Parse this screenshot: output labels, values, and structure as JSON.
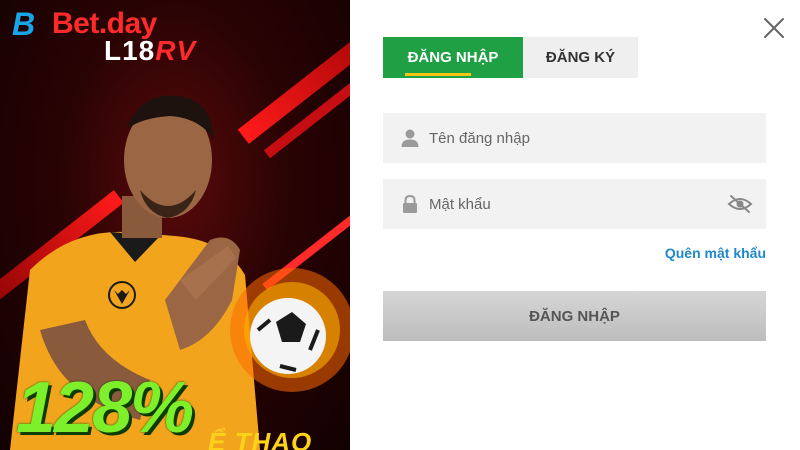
{
  "promo": {
    "brand_prefix": "B",
    "brand_name": "Bet.day",
    "sub_brand_left": "L18",
    "sub_brand_right": "RV",
    "bonus_percent": "128%",
    "bonus_caption": "Ể THAO",
    "colors": {
      "accent_red": "#e0141b",
      "brand_blue": "#18a6e8",
      "bonus_green": "#7df02b"
    }
  },
  "login": {
    "tabs": [
      {
        "label": "ĐĂNG NHẬP",
        "active": true
      },
      {
        "label": "ĐĂNG KÝ",
        "active": false
      }
    ],
    "username": {
      "placeholder": "Tên đăng nhập",
      "value": "",
      "icon": "user-icon"
    },
    "password": {
      "placeholder": "Mật khẩu",
      "value": "",
      "icon": "lock-icon",
      "toggle_icon": "eye-off-icon"
    },
    "forgot_label": "Quên mật khẩu",
    "submit_label": "ĐĂNG NHẬP",
    "close_icon": "close-icon",
    "colors": {
      "active_tab": "#1fa045",
      "tab_underline": "#f5c518",
      "link": "#1e88c8"
    }
  }
}
